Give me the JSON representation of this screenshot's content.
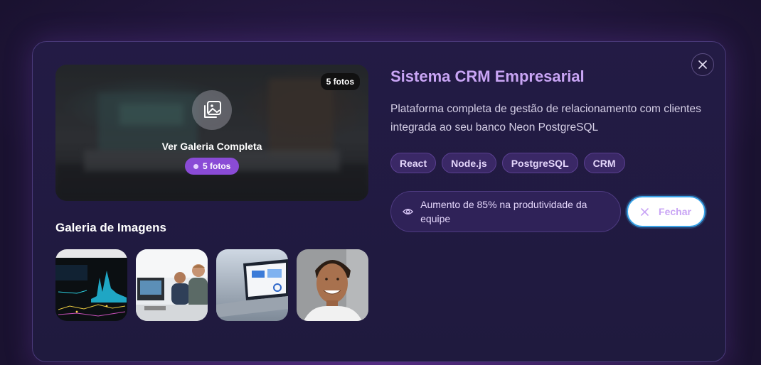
{
  "modal": {
    "title": "Sistema CRM Empresarial",
    "description": "Plataforma completa de gestão de relacionamento com clientes integrada ao seu banco Neon PostgreSQL",
    "tags": [
      "React",
      "Node.js",
      "PostgreSQL",
      "CRM"
    ],
    "metric": "Aumento de 85% na produtividade da equipe",
    "close_label": "Fechar",
    "close_icon": "close-icon"
  },
  "hero": {
    "count_badge": "5 fotos",
    "cta": "Ver Galeria Completa",
    "pill": "5 fotos",
    "icon": "gallery-icon"
  },
  "gallery": {
    "title": "Galeria de Imagens",
    "thumbs": [
      "dashboard-chart-photo",
      "office-team-photo",
      "laptop-dashboard-photo",
      "smiling-man-portrait"
    ]
  },
  "colors": {
    "accent": "#c9a5f5",
    "pill": "#8a4bd6",
    "focus_ring": "#3aa3e8"
  }
}
